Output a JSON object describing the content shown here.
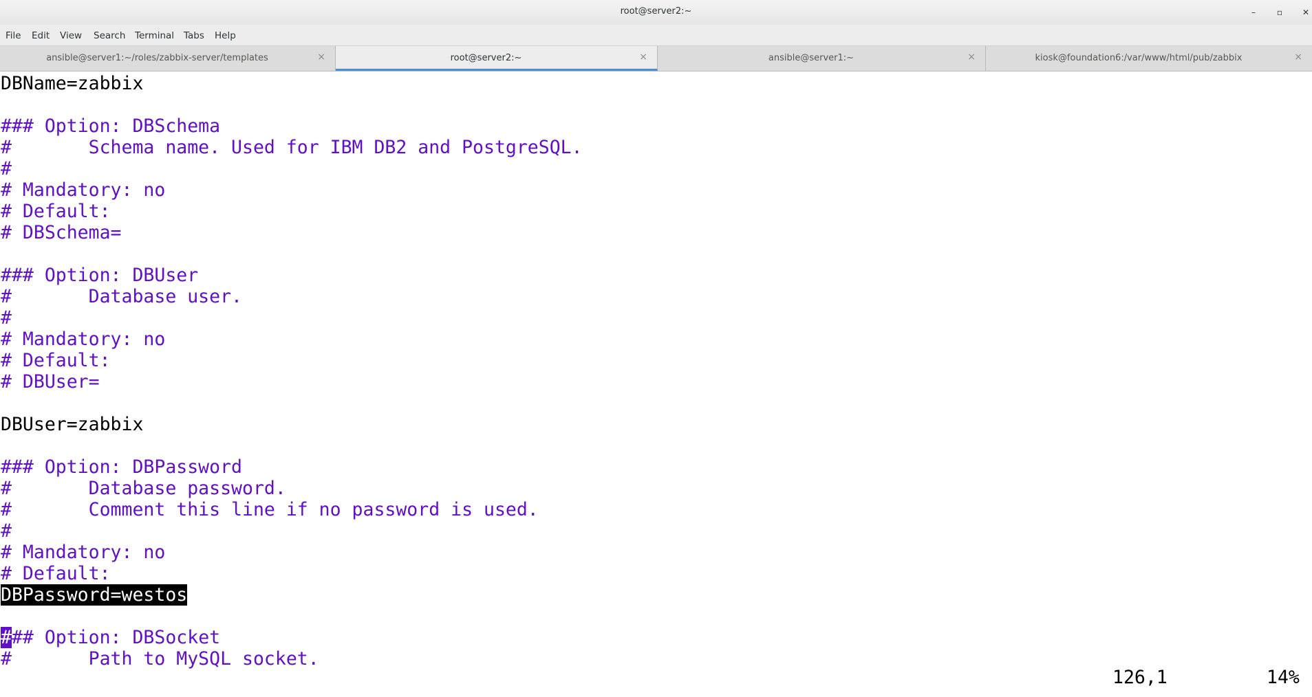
{
  "window": {
    "title": "root@server2:~",
    "minimize_label": "–",
    "maximize_label": "▫",
    "close_label": "✕"
  },
  "menubar": {
    "items": [
      "File",
      "Edit",
      "View",
      "Search",
      "Terminal",
      "Tabs",
      "Help"
    ]
  },
  "tabs": [
    {
      "label": "ansible@server1:~/roles/zabbix-server/templates",
      "active": false
    },
    {
      "label": "root@server2:~",
      "active": true
    },
    {
      "label": "ansible@server1:~",
      "active": false
    },
    {
      "label": "kiosk@foundation6:/var/www/html/pub/zabbix",
      "active": false
    }
  ],
  "tab_close_glyph": "×",
  "terminal": {
    "lines": [
      "DBName=zabbix",
      "",
      "### Option: DBSchema",
      "#       Schema name. Used for IBM DB2 and PostgreSQL.",
      "#",
      "# Mandatory: no",
      "# Default:",
      "# DBSchema=",
      "",
      "### Option: DBUser",
      "#       Database user.",
      "#",
      "# Mandatory: no",
      "# Default:",
      "# DBUser=",
      "",
      "DBUser=zabbix",
      "",
      "### Option: DBPassword",
      "#       Database password.",
      "#       Comment this line if no password is used.",
      "#",
      "# Mandatory: no",
      "# Default:",
      "DBPassword=westos",
      "",
      "### Option: DBSocket",
      "#       Path to MySQL socket."
    ],
    "highlighted_line": "DBPassword=westos",
    "cursor_char": "#",
    "cursor_line_rest": "## Option: DBSocket",
    "position": "126,1",
    "percent": "14%"
  },
  "colors": {
    "comment": "#6010c8",
    "text": "#000000",
    "active_tab_underline": "#4a90d9"
  }
}
